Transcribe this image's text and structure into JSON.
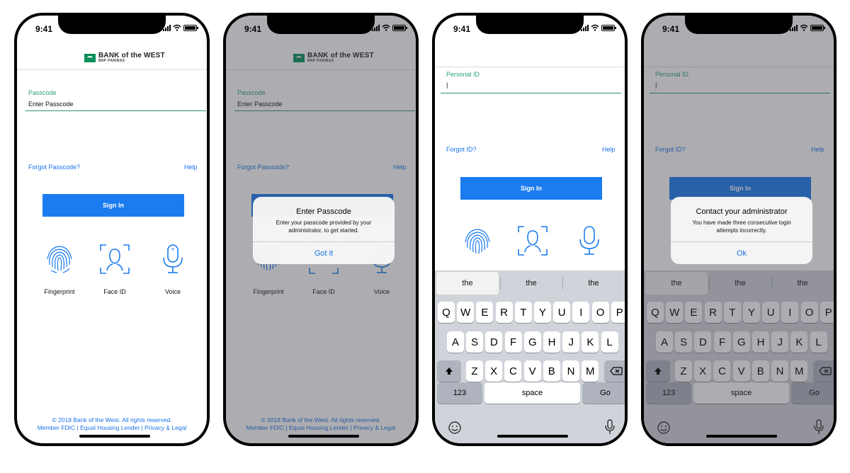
{
  "status_bar": {
    "time": "9:41"
  },
  "brand": {
    "line1": "BANK of the WEST",
    "line2": "BNP PARIBAS",
    "accent": "#0a8f5a"
  },
  "colors": {
    "primary": "#1b7cf0",
    "field_accent": "#2aa17a"
  },
  "screen1": {
    "field_label": "Passcode",
    "field_value": "Enter Passcode",
    "forgot_link": "Forgot Passcode?",
    "help_link": "Help",
    "sign_in": "Sign In",
    "biometrics": [
      {
        "label": "Fingerprint",
        "icon": "fingerprint-icon"
      },
      {
        "label": "Face ID",
        "icon": "face-id-icon"
      },
      {
        "label": "Voice",
        "icon": "microphone-icon"
      }
    ],
    "footer_line1": "© 2018 Bank of the West. All rights reserved.",
    "footer_line2": "Member FDIC | Equal Housing Lender | Privacy & Legal"
  },
  "screen2": {
    "alert_title": "Enter Passcode",
    "alert_message": "Enter your passcode provided by your administrator, to get started.",
    "alert_button": "Got it"
  },
  "screen3": {
    "field_label": "Personal ID",
    "field_value": "|",
    "forgot_link": "Forgot ID?",
    "help_link": "Help",
    "sign_in": "Sign In"
  },
  "screen4": {
    "alert_title": "Contact your administrator",
    "alert_message": "You have made three consecutive login attempts incorrectly.",
    "alert_button": "Ok"
  },
  "keyboard": {
    "suggestions": [
      "the",
      "the",
      "the"
    ],
    "row1": [
      "Q",
      "W",
      "E",
      "R",
      "T",
      "Y",
      "U",
      "I",
      "O",
      "P"
    ],
    "row2": [
      "A",
      "S",
      "D",
      "F",
      "G",
      "H",
      "J",
      "K",
      "L"
    ],
    "row3": [
      "Z",
      "X",
      "C",
      "V",
      "B",
      "N",
      "M"
    ],
    "numbers_key": "123",
    "space_key": "space",
    "go_key": "Go",
    "shift_icon": "shift-icon",
    "delete_icon": "delete-icon",
    "emoji_icon": "emoji-icon",
    "dictation_icon": "microphone-icon"
  }
}
